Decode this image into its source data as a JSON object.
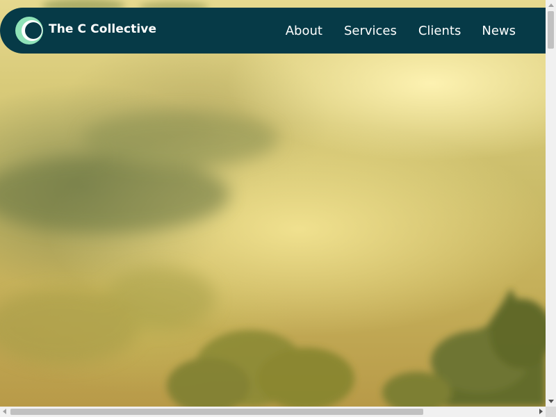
{
  "brand": {
    "name": "The C Collective",
    "logo_icon": "crescent-c-logo-icon",
    "logo_colors": [
      "#8fe3b8",
      "#ffffff"
    ]
  },
  "nav": {
    "items": [
      {
        "label": "About"
      },
      {
        "label": "Services"
      },
      {
        "label": "Clients"
      },
      {
        "label": "News"
      }
    ]
  },
  "hero": {
    "image": "misty-sunrise-forest-image"
  },
  "theme": {
    "navbar_bg": "#063a47",
    "nav_text": "#ffffff"
  }
}
